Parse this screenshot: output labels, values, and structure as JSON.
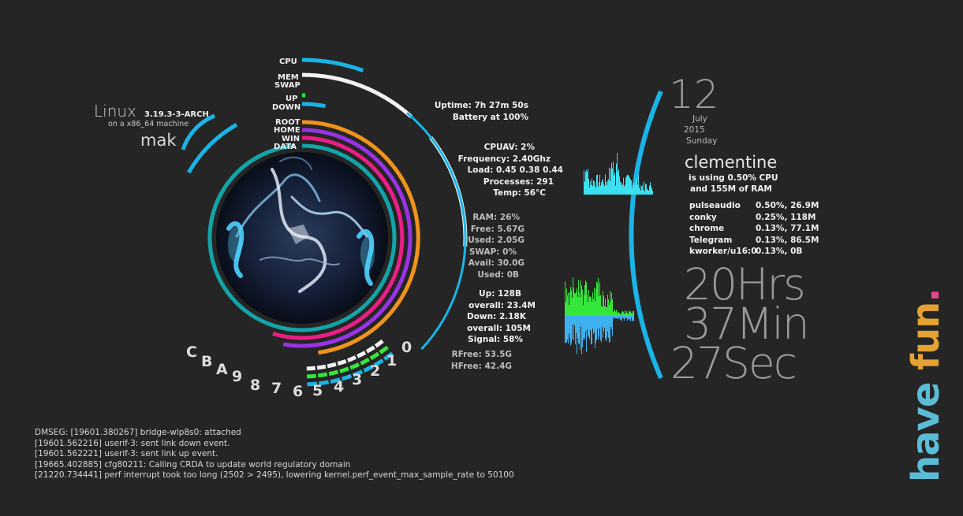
{
  "system": {
    "os": "Linux",
    "kernel": "3.19.3-3-ARCH",
    "machine": "on a x86_64 machine",
    "user": "mak"
  },
  "meters": {
    "cpu": "CPU",
    "mem": "MEM",
    "swap": "SWAP",
    "up": "UP",
    "down": "DOWN",
    "root": "ROOT",
    "home": "HOME",
    "win": "WIN",
    "data": "DATA"
  },
  "workspaces": [
    "C",
    "B",
    "A",
    "9",
    "8",
    "7",
    "6",
    "5",
    "4",
    "3",
    "2",
    "1",
    "0"
  ],
  "stats": {
    "uptime": "Uptime: 7h 27m 50s",
    "battery": "Battery at 100%",
    "cpuav": "CPUAV: 2%",
    "frequency": "Frequency: 2.40Ghz",
    "load": "Load: 0.45 0.38 0.44",
    "processes": "Processes: 291",
    "temp": "Temp: 56°C",
    "ram": "RAM: 26%",
    "free": "Free: 5.67G",
    "used": "Used: 2.05G",
    "swap": "SWAP: 0%",
    "avail": "Avail: 30.0G",
    "swap_used": "Used: 0B",
    "up": "Up: 128B",
    "up_overall": "overall: 23.4M",
    "down": "Down: 2.18K",
    "down_overall": "overall: 105M",
    "signal": "Signal: 58%",
    "rfree": "RFree: 53.5G",
    "hfree": "HFree: 42.4G"
  },
  "date": {
    "day": "12",
    "month": "July",
    "year": "2015",
    "weekday": "Sunday"
  },
  "top_process": {
    "name": "clementine",
    "cpu_line": "is using  0.50% CPU",
    "ram_line": "and 155M of RAM"
  },
  "processes": [
    {
      "name": "pulseaudio",
      "value": "0.50%, 26.9M"
    },
    {
      "name": "conky",
      "value": "0.25%, 118M"
    },
    {
      "name": "chrome",
      "value": "0.13%, 77.1M"
    },
    {
      "name": "Telegram",
      "value": "0.13%, 86.5M"
    },
    {
      "name": "kworker/u16:0",
      "value": "0.13%, 0B"
    }
  ],
  "time": {
    "hours": "20Hrs",
    "minutes": "37Min",
    "seconds": "27Sec"
  },
  "slogan": {
    "word1": "have",
    "word2": "fun",
    "dot": "."
  },
  "dmesg": [
    "DMSEG: [19601.380267] bridge-wlp8s0: attached",
    "[19601.562216] userif-3: sent link down event.",
    "[19601.562221] userif-3: sent link up event.",
    "[19665.402885] cfg80211: Calling CRDA to update world regulatory domain",
    "[21220.734441] perf interrupt took too long (2502 > 2495), lowering kernel.perf_event_max_sample_rate to 50100"
  ],
  "colors": {
    "background": "#252525",
    "cyan": "#1ab4e6",
    "white": "#f2f2f2",
    "green": "#35e63a",
    "orange": "#f0931d",
    "purple": "#9933e6",
    "magenta": "#ea1e86",
    "teal": "#13a4a8",
    "graph_cyan": "#3ce0f0",
    "graph_blue": "#3fb0ee"
  },
  "icons": {
    "avatar": "smoke-figure-avatar"
  }
}
